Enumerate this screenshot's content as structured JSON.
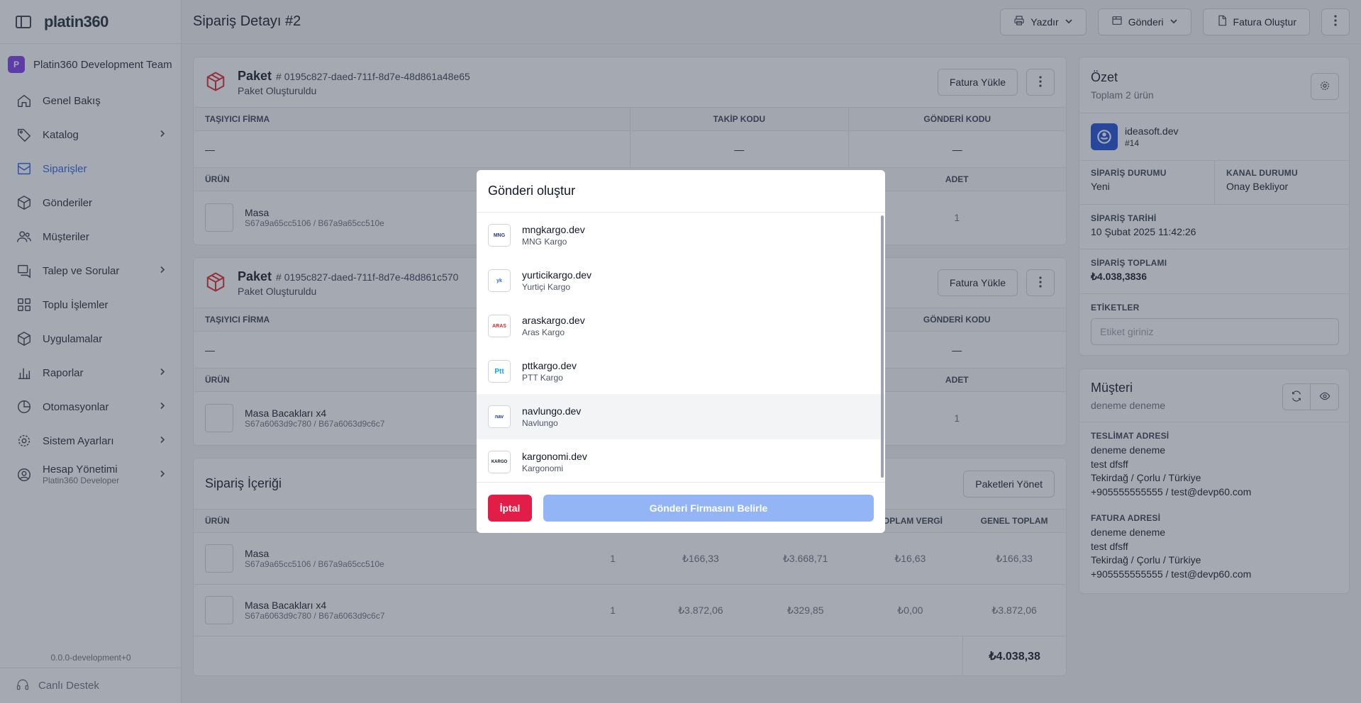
{
  "sidebar": {
    "logo": "platin360",
    "team_initial": "P",
    "team_name": "Platin360 Development Team",
    "items": [
      {
        "label": "Genel Bakış"
      },
      {
        "label": "Katalog"
      },
      {
        "label": "Siparişler"
      },
      {
        "label": "Gönderiler"
      },
      {
        "label": "Müşteriler"
      },
      {
        "label": "Talep ve Sorular"
      },
      {
        "label": "Toplu İşlemler"
      },
      {
        "label": "Uygulamalar"
      },
      {
        "label": "Raporlar"
      },
      {
        "label": "Otomasyonlar"
      },
      {
        "label": "Sistem Ayarları"
      },
      {
        "label": "Hesap Yönetimi",
        "sub": "Platin360 Developer"
      }
    ],
    "version": "0.0.0-development+0",
    "support": "Canlı Destek"
  },
  "header": {
    "title": "Sipariş Detayı #2",
    "print": "Yazdır",
    "shipment": "Gönderi",
    "invoice": "Fatura Oluştur"
  },
  "packages": [
    {
      "title": "Paket",
      "id": "# 0195c827-daed-711f-8d7e-48d861a48e65",
      "status": "Paket Oluşturuldu",
      "upload": "Fatura Yükle",
      "cols": {
        "carrier": "TAŞIYICI FİRMA",
        "tracking": "TAKİP KODU",
        "shipment": "GÖNDERİ KODU"
      },
      "dash": "—",
      "prod_cols": {
        "product": "ÜRÜN",
        "qty": "ADET"
      },
      "product": {
        "name": "Masa",
        "sku": "S67a9a65cc5106 / B67a9a65cc510e",
        "qty": "1"
      }
    },
    {
      "title": "Paket",
      "id": "# 0195c827-daed-711f-8d7e-48d861c570",
      "status": "Paket Oluşturuldu",
      "upload": "Fatura Yükle",
      "cols": {
        "carrier": "TAŞIYICI FİRMA",
        "shipment": "GÖNDERİ KODU"
      },
      "dash": "—",
      "prod_cols": {
        "product": "ÜRÜN",
        "qty": "ADET"
      },
      "product": {
        "name": "Masa Bacakları x4",
        "sku": "S67a6063d9c780 / B67a6063d9c6c7",
        "qty": "1"
      }
    }
  ],
  "order_content": {
    "title": "Sipariş İçeriği",
    "manage": "Paketleri Yönet",
    "cols": [
      "ÜRÜN",
      "TOPLAM VERGİ",
      "GENEL TOPLAM"
    ],
    "rows": [
      {
        "name": "Masa",
        "sku": "S67a9a65cc5106 / B67a9a65cc510e",
        "qty": "1",
        "price": "₺166,33",
        "c2": "₺3.668,71",
        "tax": "₺16,63",
        "total": "₺166,33"
      },
      {
        "name": "Masa Bacakları x4",
        "sku": "S67a6063d9c780 / B67a6063d9c6c7",
        "qty": "1",
        "price": "₺3.872,06",
        "c2": "₺329,85",
        "tax": "₺0,00",
        "total": "₺3.872,06"
      }
    ],
    "grand_total": "₺4.038,38"
  },
  "summary": {
    "title": "Özet",
    "subtitle": "Toplam 2 ürün",
    "store_name": "ideasoft.dev",
    "store_id": "#14",
    "order_status_label": "SİPARİŞ DURUMU",
    "order_status": "Yeni",
    "channel_status_label": "KANAL DURUMU",
    "channel_status": "Onay Bekliyor",
    "date_label": "SİPARİŞ TARİHİ",
    "date": "10 Şubat 2025 11:42:26",
    "total_label": "SİPARİŞ TOPLAMI",
    "total": "₺4.038,3836",
    "tags_label": "ETİKETLER",
    "tags_placeholder": "Etiket giriniz"
  },
  "customer": {
    "title": "Müşteri",
    "name": "deneme deneme",
    "delivery_label": "TESLİMAT ADRESİ",
    "delivery": [
      "deneme deneme",
      "test dfsff",
      "Tekirdağ / Çorlu / Türkiye",
      "+905555555555 / test@devp60.com"
    ],
    "invoice_label": "FATURA ADRESİ",
    "invoice": [
      "deneme deneme",
      "test dfsff",
      "Tekirdağ / Çorlu / Türkiye",
      "+905555555555 / test@devp60.com"
    ]
  },
  "modal": {
    "title": "Gönderi oluştur",
    "carriers": [
      {
        "name": "mngkargo.dev",
        "sub": "MNG Kargo",
        "logo_text": "MNG",
        "color": "#1e3a8a"
      },
      {
        "name": "yurticikargo.dev",
        "sub": "Yurtiçi Kargo",
        "logo_text": "yk",
        "color": "#2563eb"
      },
      {
        "name": "araskargo.dev",
        "sub": "Aras Kargo",
        "logo_text": "ARAS",
        "color": "#dc2626"
      },
      {
        "name": "pttkargo.dev",
        "sub": "PTT Kargo",
        "logo_text": "Ptt",
        "color": "#0ea5e9"
      },
      {
        "name": "navlungo.dev",
        "sub": "Navlungo",
        "logo_text": "nav",
        "color": "#1e3a8a"
      },
      {
        "name": "kargonomi.dev",
        "sub": "Kargonomi",
        "logo_text": "KARGO",
        "color": "#111827"
      }
    ],
    "cancel": "İptal",
    "confirm": "Gönderi Firmasını Belirle"
  }
}
